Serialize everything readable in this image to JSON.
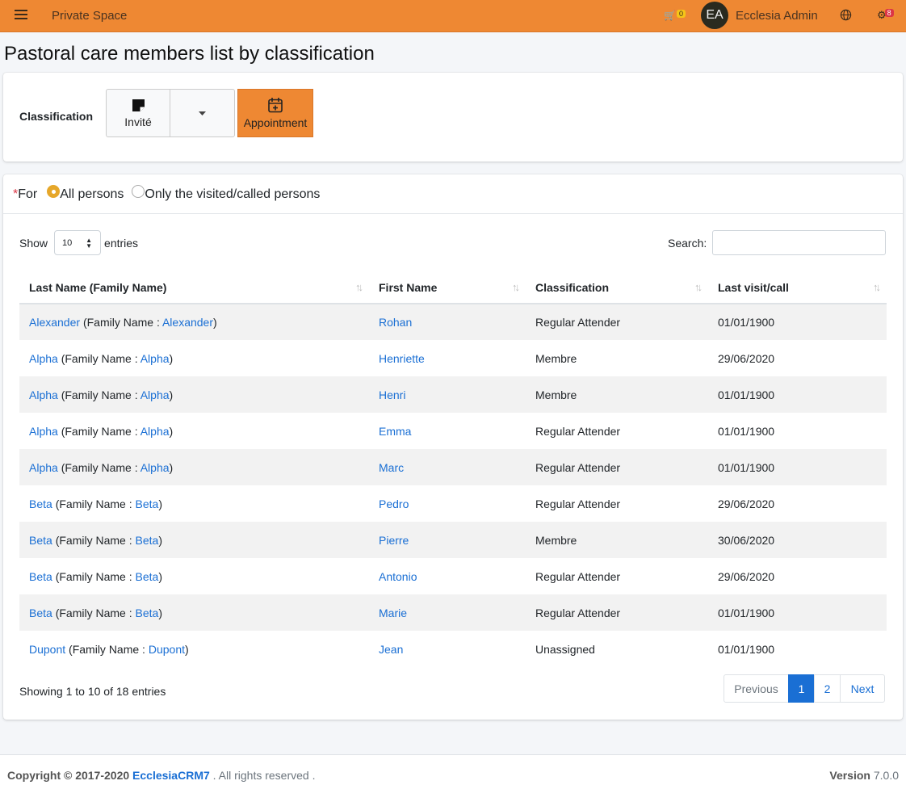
{
  "navbar": {
    "brand": "Private Space",
    "cart_count": "0",
    "avatar_initials": "EA",
    "user_name": "Ecclesia Admin",
    "notif_count": "8",
    "accent": "#ee8833"
  },
  "page": {
    "title": "Pastoral care members list by classification"
  },
  "classification": {
    "label": "Classification",
    "selected": "Invité",
    "appointment": "Appointment"
  },
  "filter": {
    "for_label": "For",
    "options": [
      "All persons",
      "Only the visited/called persons"
    ],
    "selected_index": 0
  },
  "table": {
    "show_label": "Show",
    "page_length": "10",
    "entries_label": "entries",
    "search_label": "Search:",
    "search_value": "",
    "columns": [
      "Last Name (Family Name)",
      "First Name",
      "Classification",
      "Last visit/call"
    ],
    "family_prefix": "(Family Name : ",
    "family_suffix": ")",
    "rows": [
      {
        "last": "Alexander",
        "family": "Alexander",
        "first": "Rohan",
        "classification": "Regular Attender",
        "date": "01/01/1900"
      },
      {
        "last": "Alpha",
        "family": "Alpha",
        "first": "Henriette",
        "classification": "Membre",
        "date": "29/06/2020"
      },
      {
        "last": "Alpha",
        "family": "Alpha",
        "first": "Henri",
        "classification": "Membre",
        "date": "01/01/1900"
      },
      {
        "last": "Alpha",
        "family": "Alpha",
        "first": "Emma",
        "classification": "Regular Attender",
        "date": "01/01/1900"
      },
      {
        "last": "Alpha",
        "family": "Alpha",
        "first": "Marc",
        "classification": "Regular Attender",
        "date": "01/01/1900"
      },
      {
        "last": "Beta",
        "family": "Beta",
        "first": "Pedro",
        "classification": "Regular Attender",
        "date": "29/06/2020"
      },
      {
        "last": "Beta",
        "family": "Beta",
        "first": "Pierre",
        "classification": "Membre",
        "date": "30/06/2020"
      },
      {
        "last": "Beta",
        "family": "Beta",
        "first": "Antonio",
        "classification": "Regular Attender",
        "date": "29/06/2020"
      },
      {
        "last": "Beta",
        "family": "Beta",
        "first": "Marie",
        "classification": "Regular Attender",
        "date": "01/01/1900"
      },
      {
        "last": "Dupont",
        "family": "Dupont",
        "first": "Jean",
        "classification": "Unassigned",
        "date": "01/01/1900"
      }
    ],
    "info": "Showing 1 to 10 of 18 entries",
    "pagination": {
      "previous": "Previous",
      "pages": [
        "1",
        "2"
      ],
      "active": "1",
      "next": "Next"
    }
  },
  "footer": {
    "copyright": "Copyright © 2017-2020",
    "brand": "EcclesiaCRM7",
    "rights": ". All rights reserved .",
    "version_label": "Version",
    "version": "7.0.0"
  }
}
